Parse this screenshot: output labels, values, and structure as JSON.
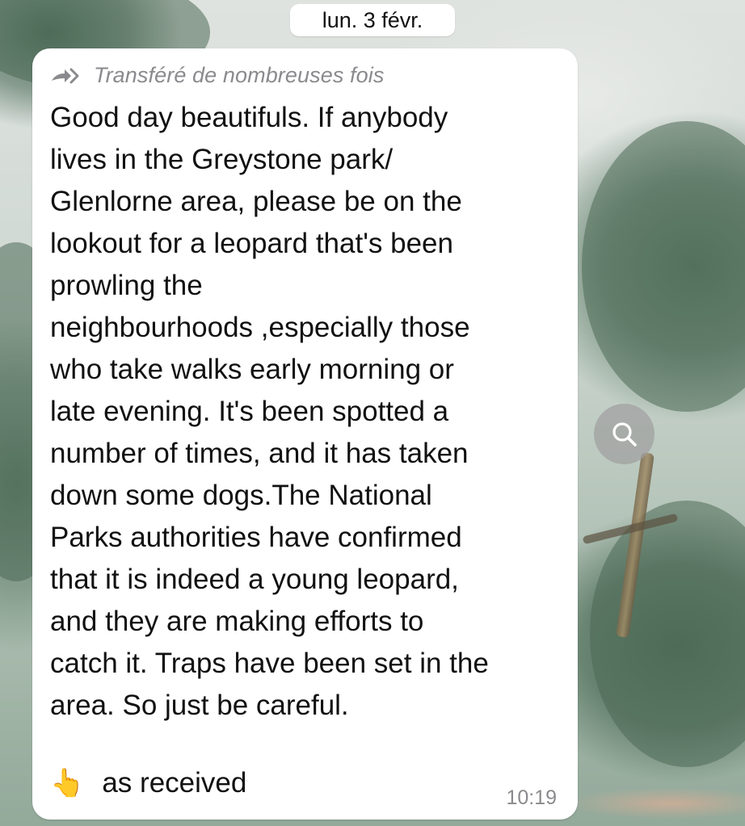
{
  "date_chip": "lun. 3 févr.",
  "message": {
    "forward_label": "Transféré de nombreuses fois",
    "body": "Good day beautifuls. If anybody\nlives in the Greystone park/\nGlenlorne area, please be on the\nlookout for a leopard that's been\nprowling the\nneighbourhoods ,especially those\nwho take walks early morning or\nlate evening.  It's been spotted a\nnumber of times, and it has taken\ndown some dogs.The National\nParks authorities have  confirmed\nthat it is indeed a young leopard,\nand they are making efforts to\ncatch it. Traps have been set in the\narea. So just be careful.",
    "footer_emoji": "👆",
    "footer_text": "as received",
    "time": "10:19"
  },
  "icons": {
    "forward": "double-forward-arrow-icon",
    "search": "search-icon"
  },
  "colors": {
    "bubble": "#ffffff",
    "secondary_text": "#8a8a8e",
    "search_button": "#a0a0a0"
  }
}
